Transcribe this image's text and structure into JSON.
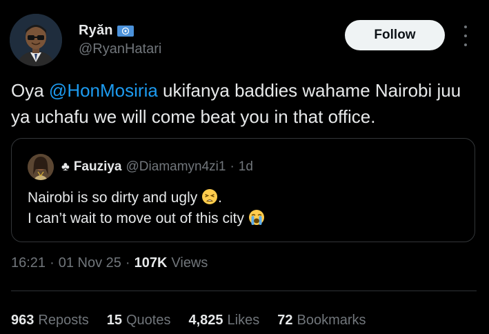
{
  "author": {
    "name": "Ryăn",
    "handle": "@RyanHatari",
    "badge_icon": "un-flag-icon"
  },
  "follow_button": {
    "label": "Follow"
  },
  "tweet": {
    "text_before": "Oya ",
    "mention": "@HonMosiria",
    "text_after": " ukifanya baddies wahame Nairobi juu ya uchafu we will come beat you in that office."
  },
  "quote": {
    "name": "Fauziya",
    "name_icon": "club-suit-icon",
    "handle": "@Diamamyn4zi1",
    "separator": "·",
    "time": "1d",
    "line1": "Nairobi is so dirty and ugly",
    "line1_emoji": "tired-face-emoji",
    "line1_end": ".",
    "line2": "I can’t wait to move out of this city",
    "line2_emoji": "crying-face-emoji"
  },
  "meta": {
    "time": "16:21",
    "sep1": "·",
    "date": "01 Nov 25",
    "sep2": "·",
    "views_count": "107K",
    "views_label": "Views"
  },
  "stats": [
    {
      "count": "963",
      "label": "Reposts"
    },
    {
      "count": "15",
      "label": "Quotes"
    },
    {
      "count": "4,825",
      "label": "Likes"
    },
    {
      "count": "72",
      "label": "Bookmarks"
    }
  ],
  "colors": {
    "background": "#000000",
    "text": "#e7e9ea",
    "secondary": "#71767b",
    "accent": "#1d9bf0",
    "border": "#333639"
  }
}
